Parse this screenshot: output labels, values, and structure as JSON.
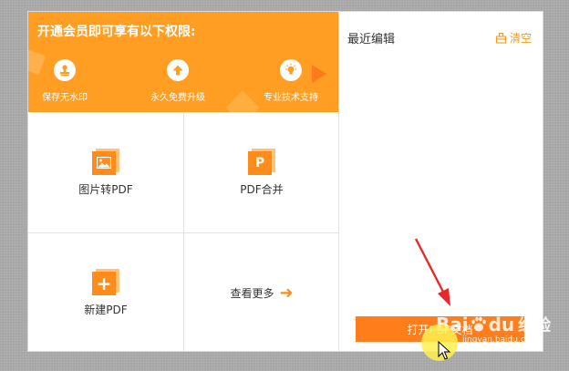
{
  "banner": {
    "title": "开通会员即可享有以下权限:",
    "perks": [
      {
        "label": "保存无水印",
        "icon": "stamp-icon"
      },
      {
        "label": "永久免费升级",
        "icon": "upload-arrow-icon"
      },
      {
        "label": "专业技术支持",
        "icon": "lightbulb-icon"
      }
    ]
  },
  "tools": [
    {
      "label": "图片转PDF",
      "icon": "image-file-icon"
    },
    {
      "label": "PDF合并",
      "icon": "pdf-file-icon",
      "glyph": "P"
    },
    {
      "label": "新建PDF",
      "icon": "new-file-icon",
      "glyph": "+"
    },
    {
      "label": "查看更多",
      "icon": "arrow-right-icon"
    }
  ],
  "recent": {
    "title": "最近编辑",
    "clear_label": "清空"
  },
  "open_button": {
    "label": "打开PDF文档"
  },
  "watermark": {
    "brand_a": "Bai",
    "brand_b": "du",
    "brand_cn": "经验",
    "url": "jingyan.baidu.com"
  },
  "colors": {
    "accent": "#ff9e23",
    "button": "#ff7d1a",
    "link": "#f39a22"
  }
}
